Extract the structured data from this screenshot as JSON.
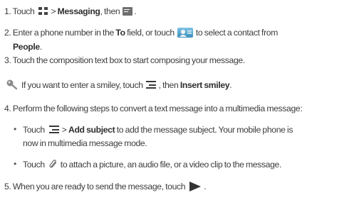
{
  "steps": {
    "s1": {
      "prefix": "1. Touch",
      "gt": ">",
      "bold": "Messaging",
      "suffix": ", then",
      "end": "."
    },
    "s2": {
      "prefix": "2. Enter a phone number in the",
      "bold": "To",
      "mid": "field, or touch",
      "suffix": "to select a contact from"
    },
    "s2b": {
      "bold": "People",
      "end": "."
    },
    "s3": {
      "text": "3. Touch the composition text box to start composing your message."
    },
    "tip": {
      "prefix": "If you want to enter a smiley, touch",
      "mid": ", then",
      "bold": "Insert smiley",
      "end": "."
    },
    "s4": {
      "text": "4. Perform the following steps to convert a text message into a multimedia message:"
    },
    "b1": {
      "bullet": "•",
      "prefix": "Touch",
      "gt": ">",
      "bold": "Add subject",
      "suffix": "to add the message subject. Your mobile phone is"
    },
    "b1b": {
      "text": "now in multimedia message mode."
    },
    "b2": {
      "bullet": "•",
      "prefix": "Touch",
      "suffix": "to attach a picture, an audio file, or a video clip to the message."
    },
    "s5": {
      "prefix": "5. When you are ready to send the message, touch",
      "end": "."
    }
  },
  "icons": {
    "apps": "apps-grid-icon",
    "compose": "new-message-icon",
    "people": "people-contacts-icon",
    "menu": "menu-icon",
    "tip": "tip-pin-icon",
    "attach": "paperclip-icon",
    "send": "send-arrow-icon"
  },
  "colors": {
    "text": "#3c3c3c",
    "icon_dark": "#333333",
    "people_icon": "#3c8fbf"
  }
}
